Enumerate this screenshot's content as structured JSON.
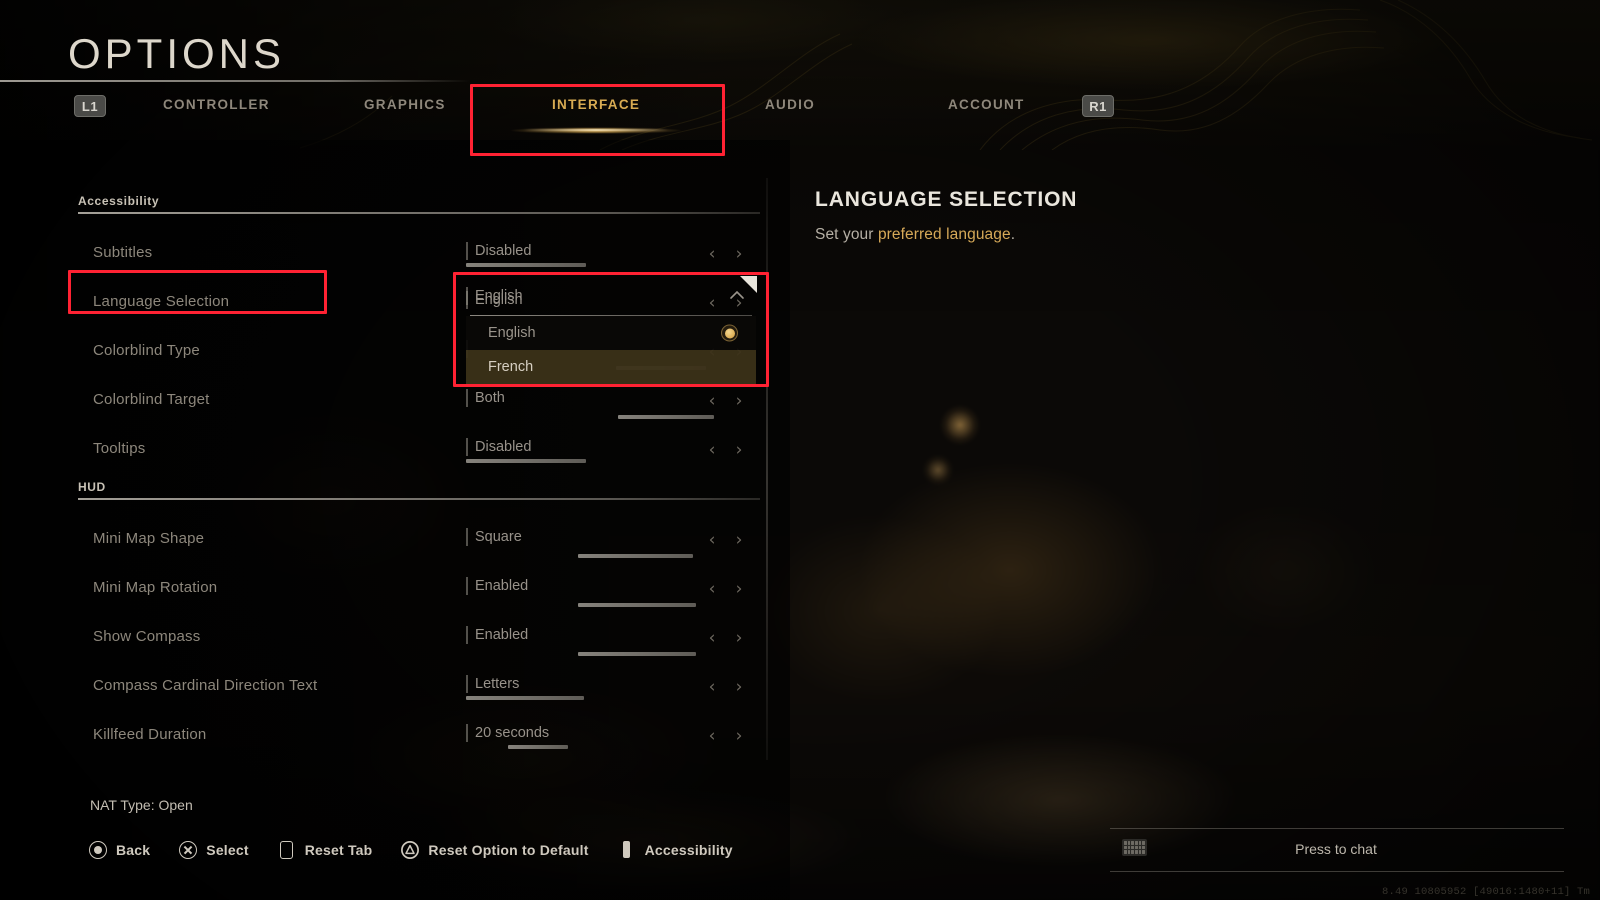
{
  "header": {
    "title": "OPTIONS",
    "bumper_left": "L1",
    "bumper_right": "R1",
    "tabs": [
      {
        "label": "CONTROLLER",
        "active": false
      },
      {
        "label": "GRAPHICS",
        "active": false
      },
      {
        "label": "INTERFACE",
        "active": true
      },
      {
        "label": "AUDIO",
        "active": false
      },
      {
        "label": "ACCOUNT",
        "active": false
      }
    ]
  },
  "settings": {
    "sections": [
      {
        "label": "Accessibility"
      },
      {
        "label": "HUD"
      }
    ],
    "rows": [
      {
        "label": "Subtitles",
        "value": "Disabled",
        "bar": 62
      },
      {
        "label": "Language Selection",
        "value": "English",
        "bar": 0
      },
      {
        "label": "Colorblind Type",
        "value": "",
        "bar": 0
      },
      {
        "label": "Colorblind Target",
        "value": "Both",
        "bar": 48
      },
      {
        "label": "Tooltips",
        "value": "Disabled",
        "bar": 62
      },
      {
        "label": "Mini Map Shape",
        "value": "Square",
        "bar": 57
      },
      {
        "label": "Mini Map Rotation",
        "value": "Enabled",
        "bar": 57
      },
      {
        "label": "Show Compass",
        "value": "Enabled",
        "bar": 57
      },
      {
        "label": "Compass Cardinal Direction Text",
        "value": "Letters",
        "bar": 62
      },
      {
        "label": "Killfeed Duration",
        "value": "20 seconds",
        "bar": 30
      }
    ],
    "arrow_left": "‹",
    "arrow_right": "›"
  },
  "dropdown": {
    "selected": "English",
    "chevron": "chevron-up-icon",
    "options": [
      {
        "label": "English",
        "selected": true,
        "highlighted": false
      },
      {
        "label": "French",
        "selected": false,
        "highlighted": true
      }
    ]
  },
  "description": {
    "title": "LANGUAGE SELECTION",
    "text_lead": "Set your ",
    "text_accent": "preferred language",
    "text_tail": "."
  },
  "footer": {
    "nat": "NAT Type: Open",
    "hints": [
      {
        "icon": "circle-button-icon",
        "label": "Back"
      },
      {
        "icon": "cross-button-icon",
        "label": "Select"
      },
      {
        "icon": "touchpad-button-icon",
        "label": "Reset Tab"
      },
      {
        "icon": "triangle-button-icon",
        "label": "Reset Option to Default"
      },
      {
        "icon": "options-button-icon",
        "label": "Accessibility"
      }
    ],
    "chat": {
      "icon": "keyboard-icon",
      "label": "Press to chat"
    },
    "build": "8.49 10805952 [49016:1480+11] Tm"
  },
  "colors": {
    "accent_gold": "#d8ab52",
    "annotation_red": "#ff2233",
    "text_primary": "#cfc9be",
    "text_muted": "#8d877c"
  }
}
